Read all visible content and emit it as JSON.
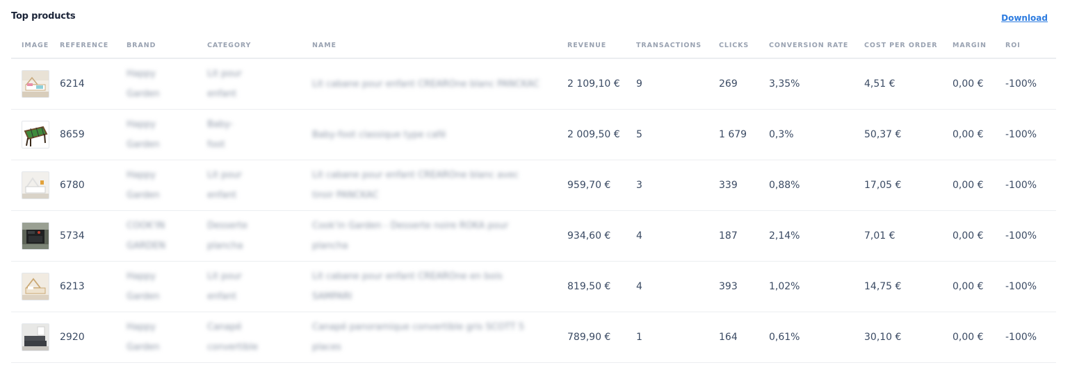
{
  "header": {
    "title": "Top products",
    "download_label": "Download"
  },
  "table": {
    "columns": {
      "image": "IMAGE",
      "reference": "REFERENCE",
      "brand": "BRAND",
      "category": "CATEGORY",
      "name": "NAME",
      "revenue": "REVENUE",
      "transactions": "TRANSACTIONS",
      "clicks": "CLICKS",
      "conversion_rate": "CONVERSION RATE",
      "cost_per_order": "COST PER ORDER",
      "margin": "MARGIN",
      "roi": "ROI"
    },
    "rows": [
      {
        "image_icon": "product-thumbnail-bed",
        "reference": "6214",
        "brand": "Happy Garden",
        "category": "Lit pour enfant",
        "name": "Lit cabane pour enfant CREAROne blanc PANCKAC",
        "revenue": "2 109,10 €",
        "transactions": "9",
        "clicks": "269",
        "conversion_rate": "3,35%",
        "cost_per_order": "4,51 €",
        "margin": "0,00 €",
        "roi": "-100%"
      },
      {
        "image_icon": "product-thumbnail-foosball",
        "reference": "8659",
        "brand": "Happy Garden",
        "category": "Baby-foot",
        "name": "Baby-foot classique type café",
        "revenue": "2 009,50 €",
        "transactions": "5",
        "clicks": "1 679",
        "conversion_rate": "0,3%",
        "cost_per_order": "50,37 €",
        "margin": "0,00 €",
        "roi": "-100%"
      },
      {
        "image_icon": "product-thumbnail-bed",
        "reference": "6780",
        "brand": "Happy Garden",
        "category": "Lit pour enfant",
        "name": "Lit cabane pour enfant CREAROne blanc avec tiroir PANCKAC",
        "revenue": "959,70 €",
        "transactions": "3",
        "clicks": "339",
        "conversion_rate": "0,88%",
        "cost_per_order": "17,05 €",
        "margin": "0,00 €",
        "roi": "-100%"
      },
      {
        "image_icon": "product-thumbnail-plancha",
        "reference": "5734",
        "brand": "COOK'IN GARDEN",
        "category": "Desserte plancha",
        "name": "Cook'in Garden - Desserte noire ROKA pour plancha",
        "revenue": "934,60 €",
        "transactions": "4",
        "clicks": "187",
        "conversion_rate": "2,14%",
        "cost_per_order": "7,01 €",
        "margin": "0,00 €",
        "roi": "-100%"
      },
      {
        "image_icon": "product-thumbnail-bed",
        "reference": "6213",
        "brand": "Happy Garden",
        "category": "Lit pour enfant",
        "name": "Lit cabane pour enfant CREAROne en bois SAMPARI",
        "revenue": "819,50 €",
        "transactions": "4",
        "clicks": "393",
        "conversion_rate": "1,02%",
        "cost_per_order": "14,75 €",
        "margin": "0,00 €",
        "roi": "-100%"
      },
      {
        "image_icon": "product-thumbnail-sofa",
        "reference": "2920",
        "brand": "Happy Garden",
        "category": "Canapé convertible",
        "name": "Canapé panoramique convertible gris SCOTT 5 places",
        "revenue": "789,90 €",
        "transactions": "1",
        "clicks": "164",
        "conversion_rate": "0,61%",
        "cost_per_order": "30,10 €",
        "margin": "0,00 €",
        "roi": "-100%"
      }
    ]
  },
  "colors": {
    "title": "#1b2438",
    "link": "#2d7ce0",
    "header_text": "#9aa3b2",
    "cell_text": "#3a4a63",
    "divider": "#eceef1"
  }
}
